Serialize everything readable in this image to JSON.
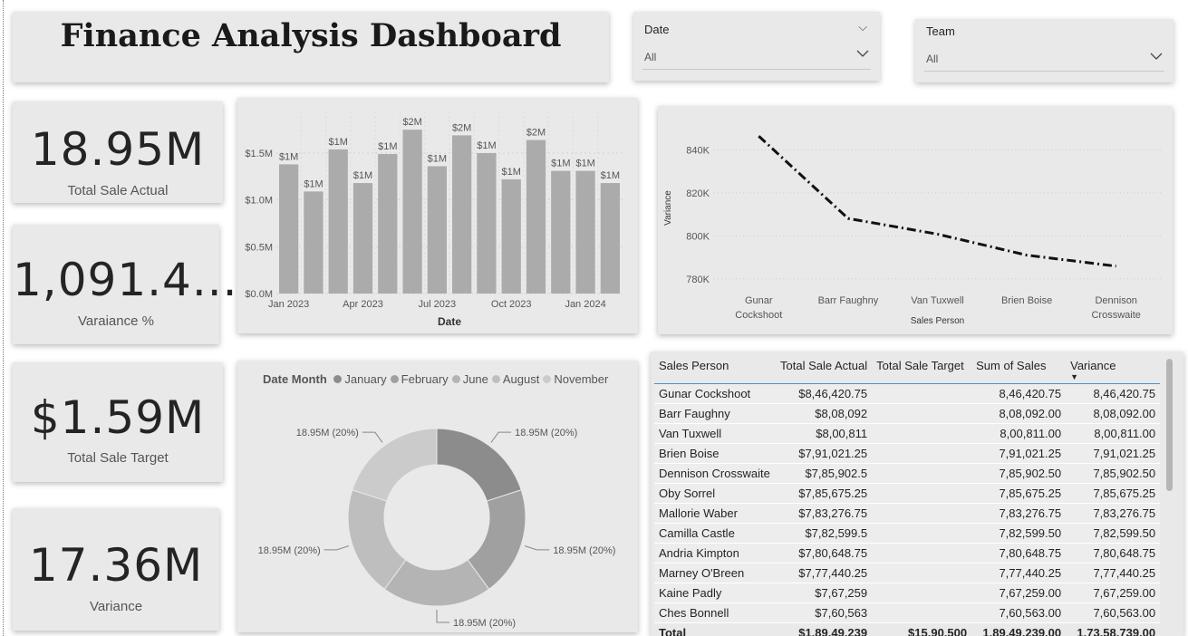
{
  "dashboard": {
    "title": "Finance Analysis Dashboard"
  },
  "slicers": {
    "date": {
      "label": "Date",
      "value": "All"
    },
    "team": {
      "label": "Team",
      "value": "All"
    }
  },
  "kpis": [
    {
      "value": "18.95M",
      "label": "Total Sale Actual"
    },
    {
      "value": "1,091.4...",
      "label": "Varaiance %"
    },
    {
      "value": "$1.59M",
      "label": "Total Sale Target"
    },
    {
      "value": "17.36M",
      "label": "Variance"
    }
  ],
  "chart_data": [
    {
      "type": "bar",
      "x_axis_type": "date",
      "categories": [
        "2023-01",
        "2023-02",
        "2023-03",
        "2023-04",
        "2023-05",
        "2023-06",
        "2023-07",
        "2023-08",
        "2023-09",
        "2023-10",
        "2023-11",
        "2023-12",
        "2024-01",
        "2024-02"
      ],
      "values": [
        1.38,
        1.09,
        1.54,
        1.18,
        1.49,
        1.75,
        1.36,
        1.69,
        1.5,
        1.22,
        1.64,
        1.31,
        1.31,
        1.18
      ],
      "data_labels": [
        "$1M",
        "$1M",
        "$1M",
        "$1M",
        "$1M",
        "$2M",
        "$1M",
        "$2M",
        "$1M",
        "$1M",
        "$2M",
        "$1M",
        "$1M",
        "$1M"
      ],
      "x_ticks": [
        {
          "month": "2023-01",
          "label": "Jan 2023"
        },
        {
          "month": "2023-04",
          "label": "Apr 2023"
        },
        {
          "month": "2023-07",
          "label": "Jul 2023"
        },
        {
          "month": "2023-10",
          "label": "Oct 2023"
        },
        {
          "month": "2024-01",
          "label": "Jan 2024"
        }
      ],
      "y_ticks": [
        {
          "value": 0,
          "label": "$0.0M"
        },
        {
          "value": 0.5,
          "label": "$0.5M"
        },
        {
          "value": 1.0,
          "label": "$1.0M"
        },
        {
          "value": 1.5,
          "label": "$1.5M"
        }
      ],
      "xlabel": "Date",
      "ylabel": "",
      "ylim": [
        0,
        1.8
      ],
      "grid": true,
      "color": "#ababab"
    },
    {
      "type": "line",
      "categories": [
        "Gunar Cockshoot",
        "Barr Faughny",
        "Van Tuxwell",
        "Brien Boise",
        "Dennison Crosswaite"
      ],
      "category_lines": [
        [
          "Gunar",
          "Cockshoot"
        ],
        [
          "Barr Faughny"
        ],
        [
          "Van Tuxwell"
        ],
        [
          "Brien Boise"
        ],
        [
          "Dennison",
          "Crosswaite"
        ]
      ],
      "values": [
        846420.75,
        808092,
        800811,
        791021.25,
        785902.5
      ],
      "y_ticks": [
        {
          "value": 780000,
          "label": "780K"
        },
        {
          "value": 800000,
          "label": "800K"
        },
        {
          "value": 820000,
          "label": "820K"
        },
        {
          "value": 840000,
          "label": "840K"
        }
      ],
      "xlabel": "Sales Person",
      "ylabel": "Variance",
      "ylim": [
        774000,
        852000
      ],
      "line_style": "dash-dot",
      "grid": true,
      "color": "#111111"
    },
    {
      "type": "pie",
      "donut": true,
      "legend_title": "Date Month",
      "legend_position": "top",
      "labels": [
        "January",
        "February",
        "June",
        "August",
        "November"
      ],
      "values": [
        18.95,
        18.95,
        18.95,
        18.95,
        18.95
      ],
      "slice_labels": [
        "18.95M (20%)",
        "18.95M (20%)",
        "18.95M (20%)",
        "18.95M (20%)",
        "18.95M (20%)"
      ],
      "colors": [
        "#8c8c8c",
        "#a0a0a0",
        "#b4b4b4",
        "#bebebe",
        "#cbcbcb"
      ]
    },
    {
      "type": "table",
      "columns": [
        "Sales Person",
        "Total Sale Actual",
        "Total Sale Target",
        "Sum of Sales",
        "Variance"
      ],
      "sorted_column": "Variance",
      "rows": [
        [
          "Gunar Cockshoot",
          "$8,46,420.75",
          "",
          "8,46,420.75",
          "8,46,420.75"
        ],
        [
          "Barr Faughny",
          "$8,08,092",
          "",
          "8,08,092.00",
          "8,08,092.00"
        ],
        [
          "Van Tuxwell",
          "$8,00,811",
          "",
          "8,00,811.00",
          "8,00,811.00"
        ],
        [
          "Brien Boise",
          "$7,91,021.25",
          "",
          "7,91,021.25",
          "7,91,021.25"
        ],
        [
          "Dennison Crosswaite",
          "$7,85,902.5",
          "",
          "7,85,902.50",
          "7,85,902.50"
        ],
        [
          "Oby Sorrel",
          "$7,85,675.25",
          "",
          "7,85,675.25",
          "7,85,675.25"
        ],
        [
          "Mallorie Waber",
          "$7,83,276.75",
          "",
          "7,83,276.75",
          "7,83,276.75"
        ],
        [
          "Camilla Castle",
          "$7,82,599.5",
          "",
          "7,82,599.50",
          "7,82,599.50"
        ],
        [
          "Andria Kimpton",
          "$7,80,648.75",
          "",
          "7,80,648.75",
          "7,80,648.75"
        ],
        [
          "Marney O'Breen",
          "$7,77,440.25",
          "",
          "7,77,440.25",
          "7,77,440.25"
        ],
        [
          "Kaine Padly",
          "$7,67,259",
          "",
          "7,67,259.00",
          "7,67,259.00"
        ],
        [
          "Ches Bonnell",
          "$7,60,563",
          "",
          "7,60,563.00",
          "7,60,563.00"
        ]
      ],
      "total": [
        "Total",
        "$1,89,49,239",
        "$15,90,500",
        "1,89,49,239.00",
        "1,73,58,739.00"
      ]
    }
  ]
}
